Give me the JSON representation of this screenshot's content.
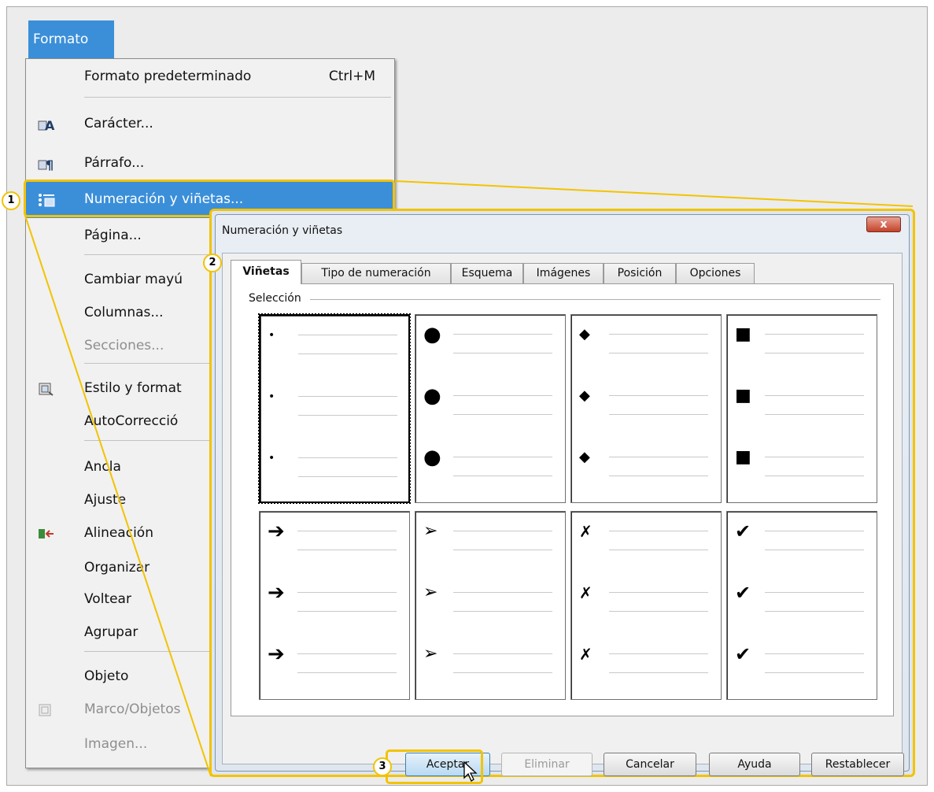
{
  "menu": {
    "title": "Formato",
    "items": [
      {
        "label": "Formato predeterminado",
        "shortcut": "Ctrl+M"
      },
      {
        "label": "Carácter..."
      },
      {
        "label": "Párrafo..."
      },
      {
        "label": "Numeración y viñetas..."
      },
      {
        "label": "Página..."
      },
      {
        "label": "Cambiar mayú"
      },
      {
        "label": "Columnas..."
      },
      {
        "label": "Secciones..."
      },
      {
        "label": "Estilo y format"
      },
      {
        "label": "AutoCorrecció"
      },
      {
        "label": "Ancla"
      },
      {
        "label": "Ajuste"
      },
      {
        "label": "Alineación"
      },
      {
        "label": "Organizar"
      },
      {
        "label": "Voltear"
      },
      {
        "label": "Agrupar"
      },
      {
        "label": "Objeto"
      },
      {
        "label": "Marco/Objetos"
      },
      {
        "label": "Imagen..."
      }
    ]
  },
  "callouts": [
    "1",
    "2",
    "3"
  ],
  "dialog": {
    "title": "Numeración y viñetas",
    "close_label": "x",
    "tabs": [
      "Viñetas",
      "Tipo de numeración",
      "Esquema",
      "Imágenes",
      "Posición",
      "Opciones"
    ],
    "active_tab": "Viñetas",
    "section_label": "Selección",
    "bullets": [
      "•",
      "●",
      "◆",
      "■",
      "➔",
      "➢",
      "✗",
      "✔"
    ],
    "buttons": {
      "accept": "Aceptar",
      "delete": "Eliminar",
      "cancel": "Cancelar",
      "help": "Ayuda",
      "reset": "Restablecer"
    }
  }
}
